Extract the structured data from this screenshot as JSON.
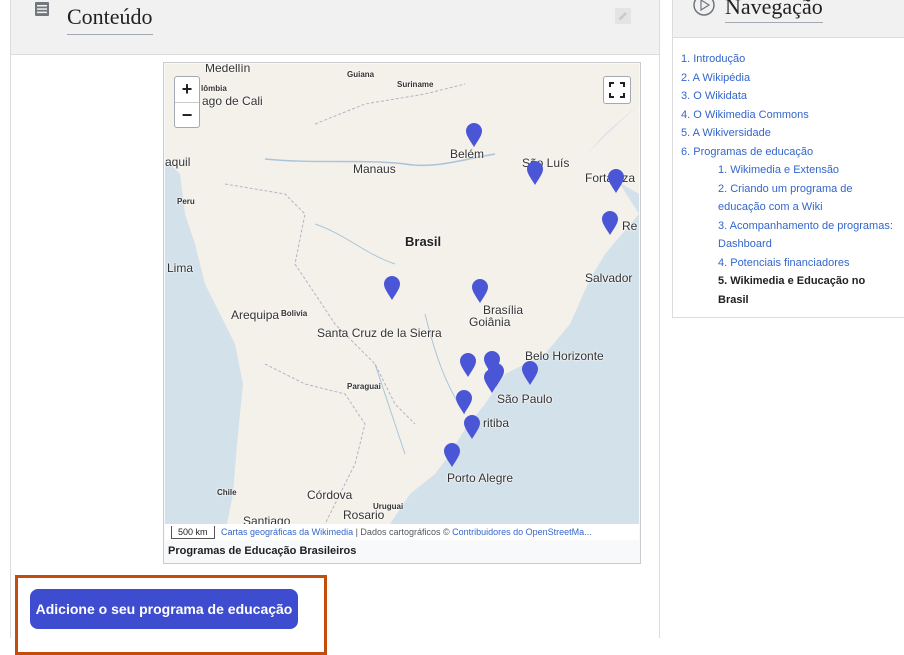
{
  "content": {
    "title": "Conteúdo",
    "doc_icon": "list-icon",
    "edit_icon": "edit-icon"
  },
  "map": {
    "zoom_in": "+",
    "zoom_out": "−",
    "fullscreen_icon": "fullscreen-icon",
    "labels": {
      "medellin": "Medellín",
      "colombia": "lômbia",
      "cali": "ago de Cali",
      "guiana": "Guiana",
      "suriname": "Suriname",
      "belem": "Belém",
      "sao_luis": "São Luís",
      "fortaleza": "Fortaleza",
      "recife": "Re",
      "aquil": "aquil",
      "manaus": "Manaus",
      "peru": "Peru",
      "brasil": "Brasil",
      "lima": "Lima",
      "salvador": "Salvador",
      "brasilia": "Brasília",
      "goiania": "Goiânia",
      "arequipa": "Arequipa",
      "bolivia": "Bolivia",
      "santa_cruz": "Santa Cruz de la Sierra",
      "belo_horizonte": "Belo Horizonte",
      "paraguai": "Paraguai",
      "sao_paulo": "São Paulo",
      "curitiba": "ritiba",
      "porto_alegre": "Porto Alegre",
      "chile": "Chile",
      "cordoba": "Córdova",
      "uruguai": "Uruguai",
      "rosario": "Rosario",
      "santiago": "Santiago"
    },
    "scale": "500 km",
    "attribution_link1": "Cartas geográficas da Wikimedia",
    "attribution_sep": " | Dados cartográficos © ",
    "attribution_link2": "Contribuidores do OpenStreetMa...",
    "caption": "Programas de Educação Brasileiros",
    "marker_color": "#4a56d6"
  },
  "add_button": {
    "label": "Adicione o seu programa de educação",
    "color": "#3e4ccf"
  },
  "navigation": {
    "title": "Navegação",
    "items": [
      {
        "label": "1. Introdução"
      },
      {
        "label": "2. A Wikipédia"
      },
      {
        "label": "3. O Wikidata"
      },
      {
        "label": "4. O Wikimedia Commons"
      },
      {
        "label": "5. A Wikiversidade"
      },
      {
        "label": "6. Programas de educação"
      }
    ],
    "subitems": [
      {
        "label": "1. Wikimedia e Extensão"
      },
      {
        "label": "2. Criando um programa de educação com a Wiki"
      },
      {
        "label": "3. Acompanhamento de programas: Dashboard"
      },
      {
        "label": "4. Potenciais financiadores"
      },
      {
        "label": "5. Wikimedia e Educação no Brasil"
      }
    ]
  }
}
